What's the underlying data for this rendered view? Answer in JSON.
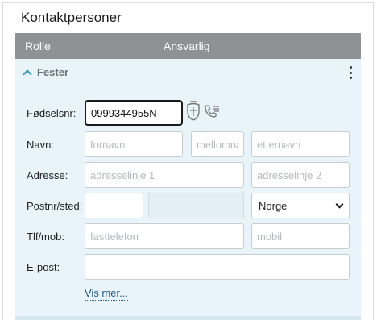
{
  "title": "Kontaktpersoner",
  "table_header": {
    "role": "Rolle",
    "responsible": "Ansvarlig"
  },
  "section": {
    "label": "Fester"
  },
  "form": {
    "birth_number": {
      "label": "Fødselsnr:",
      "value": "0999344955N"
    },
    "name": {
      "label": "Navn:",
      "first_placeholder": "fornavn",
      "middle_placeholder": "mellomnavn",
      "last_placeholder": "etternavn"
    },
    "address": {
      "label": "Adresse:",
      "line1_placeholder": "adresselinje 1",
      "line2_placeholder": "adresselinje 2"
    },
    "postal": {
      "label": "Postnr/sted:",
      "country": "Norge"
    },
    "phone": {
      "label": "Tlf/mob:",
      "landline_placeholder": "fasttelefon",
      "mobile_placeholder": "mobil"
    },
    "email": {
      "label": "E-post:"
    },
    "more_link": "Vis mer..."
  },
  "icons": {
    "lookup": "coat-of-arms-icon",
    "phone_lookup": "phone-list-icon"
  }
}
